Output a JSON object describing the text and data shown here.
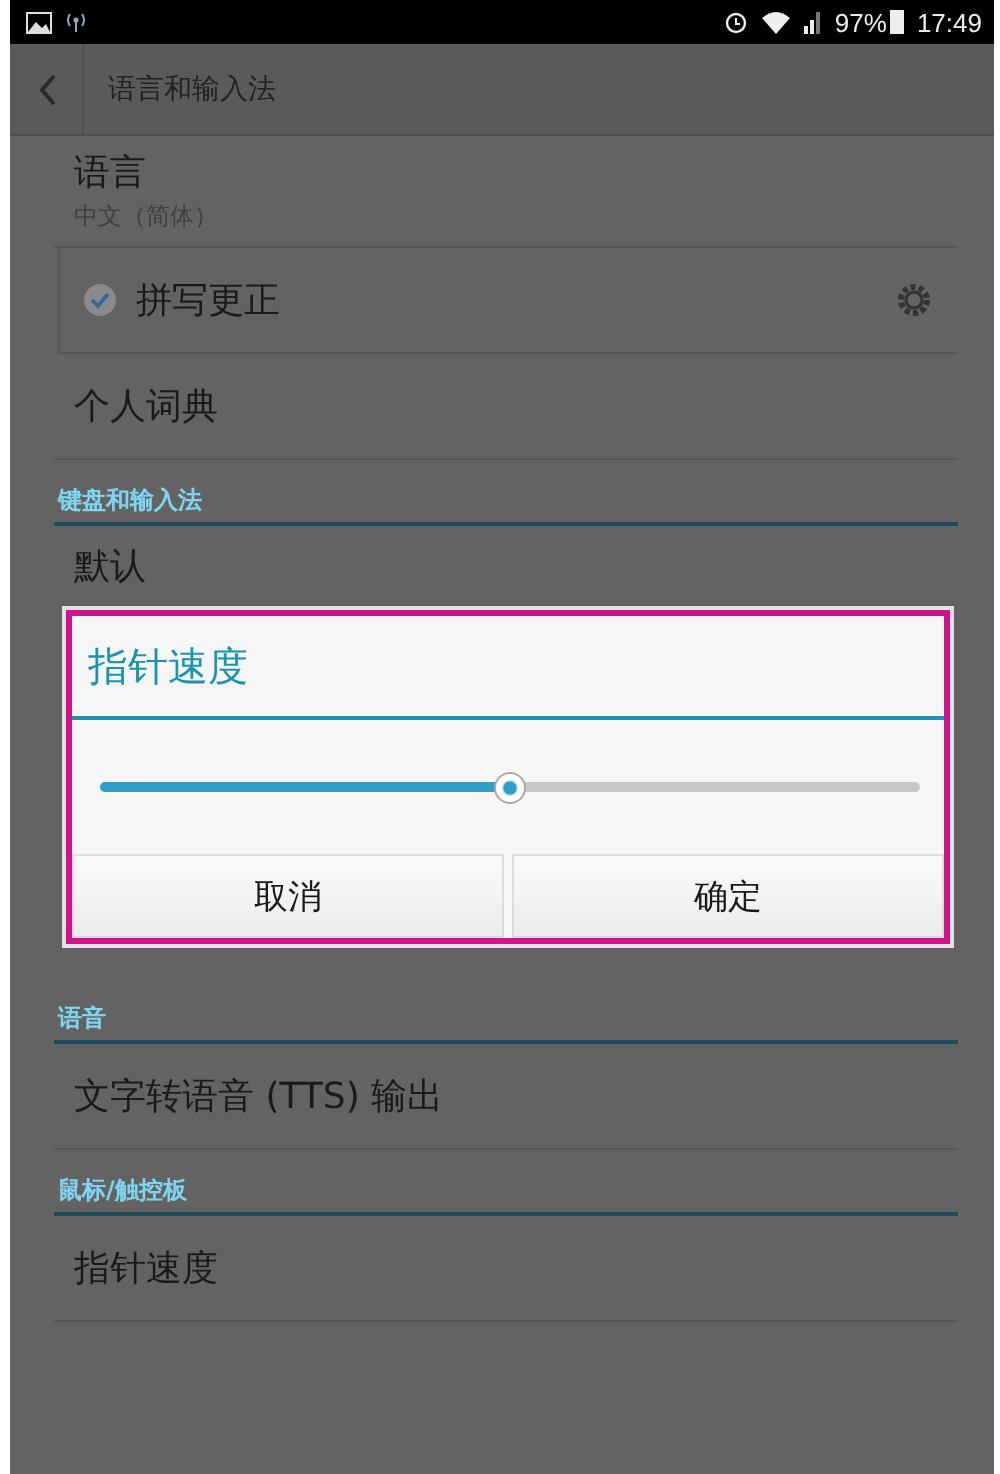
{
  "status_bar": {
    "battery": "97%",
    "time": "17:49"
  },
  "action_bar": {
    "title": "语言和输入法"
  },
  "list": [
    {
      "kind": "item",
      "title": "语言",
      "summary": "中文（简体）"
    },
    {
      "kind": "check",
      "title": "拼写更正",
      "checked": true
    },
    {
      "kind": "item",
      "title": "个人词典"
    },
    {
      "kind": "header",
      "title": "键盘和输入法"
    },
    {
      "kind": "item",
      "title": "默认",
      "covered": true
    },
    {
      "kind": "gap"
    },
    {
      "kind": "header",
      "title": "语音"
    },
    {
      "kind": "item",
      "title": "文字转语音 (TTS) 输出"
    },
    {
      "kind": "header",
      "title": "鼠标/触控板"
    },
    {
      "kind": "item",
      "title": "指针速度"
    }
  ],
  "dialog": {
    "title": "指针速度",
    "slider": {
      "level": 0.5
    },
    "buttons": [
      "取消",
      "确定"
    ]
  }
}
